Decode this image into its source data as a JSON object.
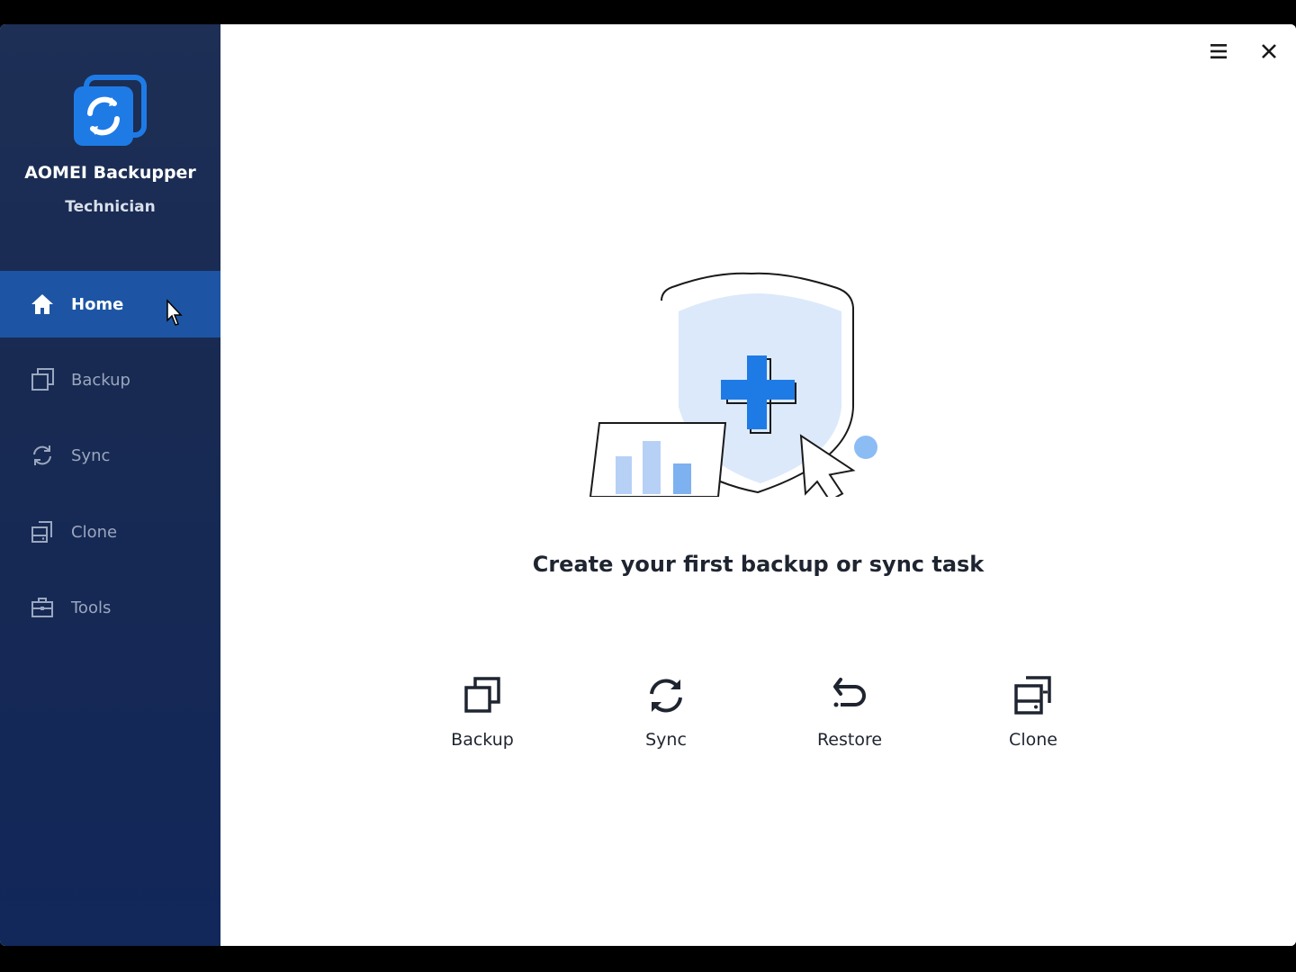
{
  "app": {
    "name": "AOMEI Backupper",
    "edition": "Technician"
  },
  "colors": {
    "sidebar_bg": "#182a52",
    "active_nav": "#1d55a4",
    "accent": "#1e7be6",
    "shield_fill": "#dce9fb"
  },
  "sidebar": {
    "items": [
      {
        "label": "Home",
        "icon": "home-icon",
        "active": true
      },
      {
        "label": "Backup",
        "icon": "backup-icon",
        "active": false
      },
      {
        "label": "Sync",
        "icon": "sync-icon",
        "active": false
      },
      {
        "label": "Clone",
        "icon": "clone-icon",
        "active": false
      },
      {
        "label": "Tools",
        "icon": "toolbox-icon",
        "active": false
      }
    ]
  },
  "window_controls": {
    "menu_icon": "menu-icon",
    "close_icon": "close-icon"
  },
  "main": {
    "headline": "Create your first backup or sync task",
    "actions": [
      {
        "label": "Backup",
        "icon": "backup-icon"
      },
      {
        "label": "Sync",
        "icon": "sync-icon"
      },
      {
        "label": "Restore",
        "icon": "restore-icon"
      },
      {
        "label": "Clone",
        "icon": "clone-icon"
      }
    ]
  }
}
